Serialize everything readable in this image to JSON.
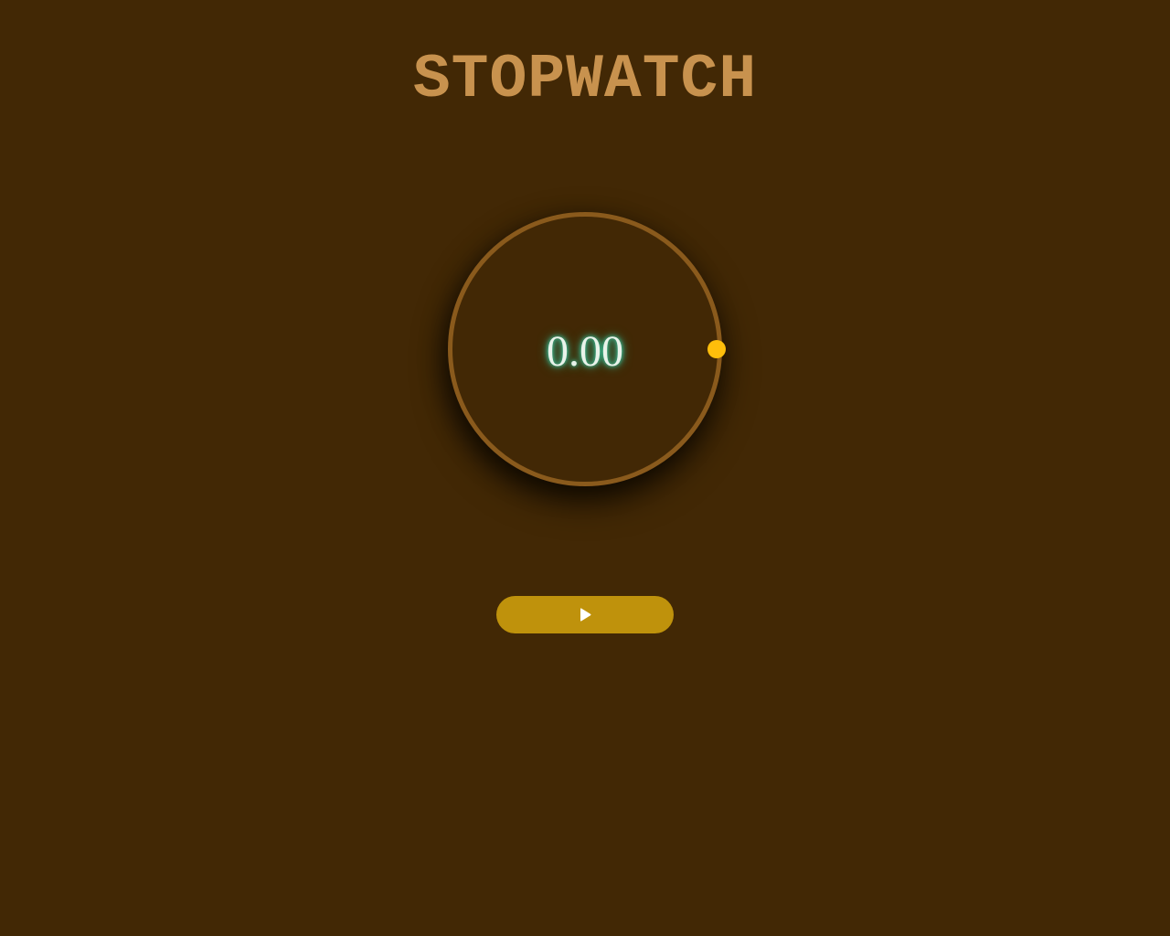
{
  "header": {
    "title": "STOPWATCH"
  },
  "stopwatch": {
    "elapsed": "0.00"
  },
  "controls": {
    "play_icon": "play-icon"
  },
  "colors": {
    "background": "#422805",
    "title": "#c8924e",
    "ring": "#8a5a1c",
    "indicator": "#ffbe0b",
    "button": "#bf920c",
    "time_glow": "#2fb891"
  }
}
